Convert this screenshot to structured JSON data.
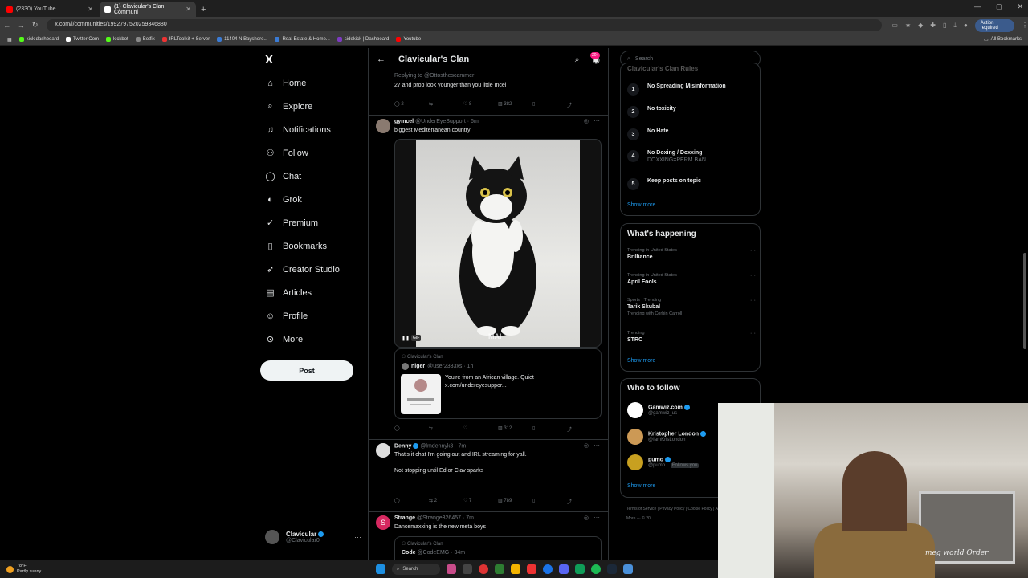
{
  "browser": {
    "tabs": [
      {
        "label": "(2330) YouTube",
        "color": "#ff0000",
        "active": false
      },
      {
        "label": "(1) Clavicular's Clan Communi",
        "color": "#ffffff",
        "active": true
      }
    ],
    "url": "x.com/i/communities/1992797520259346880",
    "action_required": "Action required",
    "bookmarks": [
      {
        "label": "kick dashboard",
        "color": "#53fc18"
      },
      {
        "label": "Twitter Com",
        "color": "#ffffff"
      },
      {
        "label": "kickbot",
        "color": "#53fc18"
      },
      {
        "label": "Botfix",
        "color": "#888888"
      },
      {
        "label": "IRLToolkit + Server",
        "color": "#e33"
      },
      {
        "label": "11404 N Bayshore...",
        "color": "#3a7bd5"
      },
      {
        "label": "Real Estate & Home...",
        "color": "#3a7bd5"
      },
      {
        "label": "sidekick | Dashboard",
        "color": "#7d3ac1"
      },
      {
        "label": "Youtube",
        "color": "#ff0000"
      }
    ],
    "all_bookmarks": "All Bookmarks"
  },
  "sidebar": {
    "logo": "X",
    "items": [
      {
        "label": "Home",
        "icon": "⌂"
      },
      {
        "label": "Explore",
        "icon": "⌕"
      },
      {
        "label": "Notifications",
        "icon": "🔔"
      },
      {
        "label": "Follow",
        "icon": "+"
      },
      {
        "label": "Chat",
        "icon": "◯"
      },
      {
        "label": "Grok",
        "icon": "◐"
      },
      {
        "label": "Premium",
        "icon": "✓"
      },
      {
        "label": "Bookmarks",
        "icon": "▯"
      },
      {
        "label": "Creator Studio",
        "icon": "➶"
      },
      {
        "label": "Articles",
        "icon": "▤"
      },
      {
        "label": "Profile",
        "icon": "☺"
      },
      {
        "label": "More",
        "icon": "⋯"
      }
    ],
    "post_label": "Post",
    "account": {
      "name": "Clavicular",
      "handle": "@Clavicular0"
    }
  },
  "main": {
    "title": "Clavicular's Clan",
    "badge": "20+",
    "tweets": [
      {
        "reply_to": "Replying to @Ottosthescammer",
        "text": "27 and prob look younger than you little Incel",
        "replies": "2",
        "retweets": "",
        "likes": "8",
        "views": "382"
      },
      {
        "name": "gymcel",
        "handle": "@UnderEyeSupport · 6m",
        "text": "biggest Mediterranean country",
        "gif_label": "GIF",
        "watermark": "MAI",
        "quote": {
          "community": "Clavicular's Clan",
          "name": "niger",
          "handle": "@user2333xs · 1h",
          "text": "You're from an African village. Quiet",
          "link": "x.com/undereyesuppor..."
        },
        "replies": "",
        "retweets": "",
        "likes": "",
        "views": "312"
      },
      {
        "name": "Denny",
        "handle": "@lmdennyk3 · 7m",
        "text": "That's it chat I'm going out and IRL streaming for yall.",
        "text2": "Not stopping until Ed or Clav sparks",
        "replies": "",
        "retweets": "2",
        "likes": "7",
        "views": "789"
      },
      {
        "name": "Strange",
        "handle": "@Strange326457 · 7m",
        "text": "Dancemaxxing is the new meta boys",
        "quote": {
          "community": "Clavicular's Clan",
          "name": "Code",
          "handle": "@CodeEMG · 34m"
        }
      }
    ]
  },
  "right": {
    "search_placeholder": "Search",
    "rules_title": "Clavicular's Clan Rules",
    "rules": [
      {
        "n": "1",
        "label": "No Spreading Misinformation",
        "sub": ""
      },
      {
        "n": "2",
        "label": "No toxicity",
        "sub": ""
      },
      {
        "n": "3",
        "label": "No Hate",
        "sub": ""
      },
      {
        "n": "4",
        "label": "No Doxing / Doxxing",
        "sub": "DOXXING=PERM BAN"
      },
      {
        "n": "5",
        "label": "Keep posts on topic",
        "sub": ""
      }
    ],
    "show_more": "Show more",
    "happening_title": "What's happening",
    "trends": [
      {
        "context": "Trending in United States",
        "name": "Brilliance",
        "extra": ""
      },
      {
        "context": "Trending in United States",
        "name": "April Fools",
        "extra": ""
      },
      {
        "context": "Sports · Trending",
        "name": "Tarik Skubal",
        "extra": "Trending with Corbin Carroll"
      },
      {
        "context": "Trending",
        "name": "STRC",
        "extra": ""
      }
    ],
    "follow_title": "Who to follow",
    "follows": [
      {
        "name": "Gamwiz.com",
        "handle": "@gamwiz_us",
        "color": "#ffffff"
      },
      {
        "name": "Kristopher London",
        "handle": "@IamKrisLondon",
        "color": "#c95"
      },
      {
        "name": "pumo",
        "handle": "@pumo...",
        "color": "#c8a020",
        "follows_you": "Follows you"
      }
    ],
    "footer": "Terms of Service  |  Privacy Policy  |  Cookie Policy  |  Accessibility  |  Ads info  |  More ···  © 20"
  },
  "taskbar": {
    "temp": "78°F",
    "weather": "Partly sunny",
    "search": "Search"
  },
  "webcam": {
    "signature": "meg world Order"
  }
}
